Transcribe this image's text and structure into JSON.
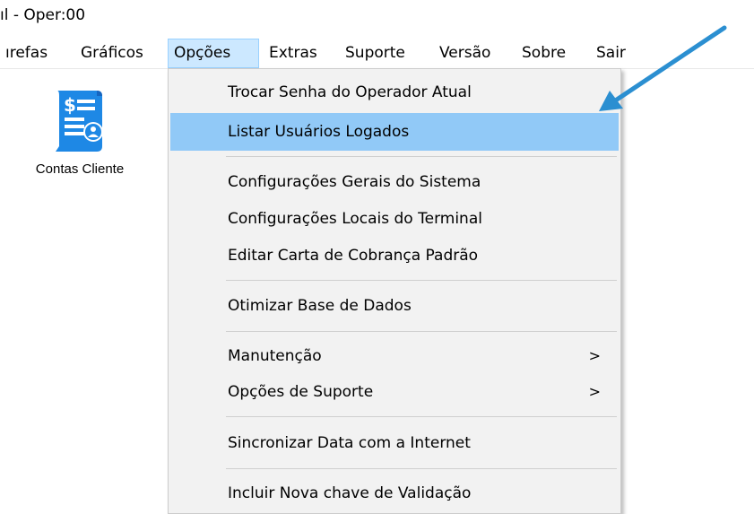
{
  "window": {
    "title": "ıl - Oper:00"
  },
  "menubar": {
    "items": [
      {
        "label": "ırefas"
      },
      {
        "label": "Gráficos"
      },
      {
        "label": "Opções"
      },
      {
        "label": "Extras"
      },
      {
        "label": "Suporte"
      },
      {
        "label": "Versão"
      },
      {
        "label": "Sobre"
      },
      {
        "label": "Sair"
      }
    ]
  },
  "toolbar": {
    "contas_cliente": {
      "label": "Contas Cliente",
      "icon": "invoice-user-icon"
    }
  },
  "dropdown": {
    "items": [
      {
        "label": "Trocar Senha do Operador Atual"
      },
      {
        "label": "Listar Usuários Logados"
      },
      {
        "label": "Configurações Gerais do Sistema"
      },
      {
        "label": "Configurações Locais do Terminal"
      },
      {
        "label": "Editar Carta de Cobrança Padrão"
      },
      {
        "label": "Otimizar Base de Dados"
      },
      {
        "label": "Manutenção",
        "submenu_glyph": ">"
      },
      {
        "label": "Opções de Suporte",
        "submenu_glyph": ">"
      },
      {
        "label": "Sincronizar Data com a Internet"
      },
      {
        "label": "Incluir Nova chave de Validação"
      }
    ]
  },
  "colors": {
    "highlight": "#91c9f7",
    "active_menu": "#cce8ff",
    "arrow": "#2b8fd1",
    "icon_blue": "#1e88e5"
  }
}
